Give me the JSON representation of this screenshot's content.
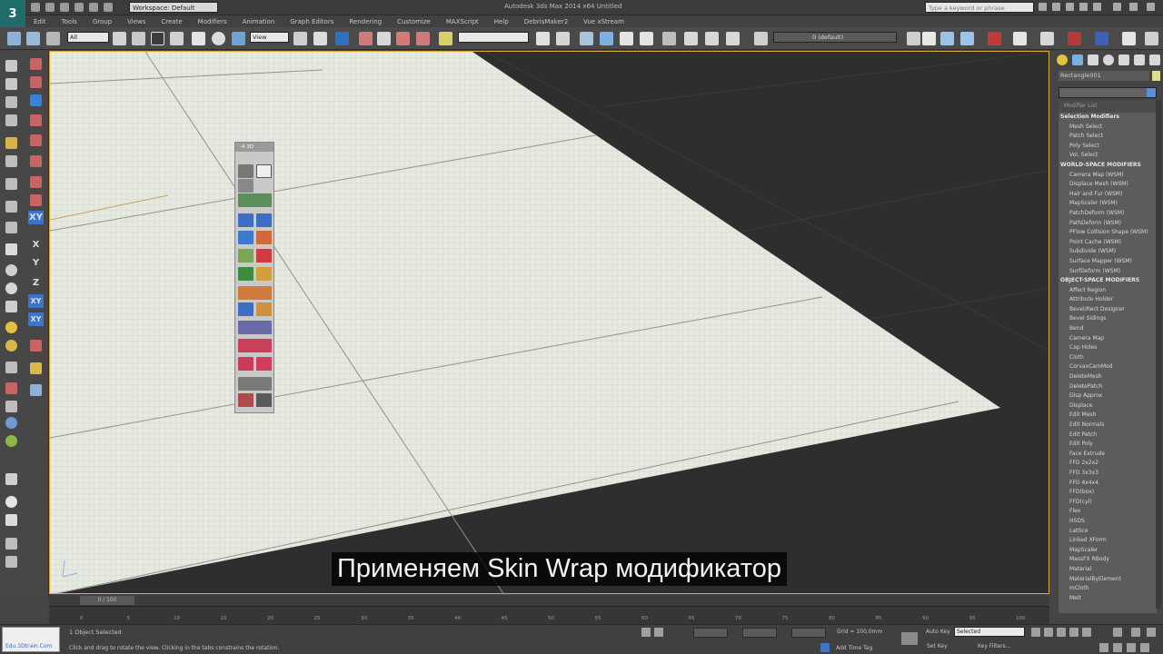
{
  "titlebar": {
    "workspace": "Workspace: Default",
    "app_title": "Autodesk 3ds Max  2014 x64     Untitled",
    "search_placeholder": "Type a keyword or phrase"
  },
  "menu": [
    "Edit",
    "Tools",
    "Group",
    "Views",
    "Create",
    "Modifiers",
    "Animation",
    "Graph Editors",
    "Rendering",
    "Customize",
    "MAXScript",
    "Help",
    "DebrisMaker2",
    "Vue xStream"
  ],
  "toolbar": {
    "selection_filter": "All",
    "ref_coord": "View",
    "layer": "0 (default)"
  },
  "left_axes": [
    "XY",
    "X",
    "Y",
    "Z",
    "XY",
    "XY"
  ],
  "viewport": {
    "subtitle": "Применяем Skin Wrap модификатор",
    "colors": {
      "plane": "#e5e9e0",
      "grid": "#8f9490",
      "bg": "#2e2e2e",
      "border": "#d9a93a"
    },
    "float_tb_title": "-4 3D"
  },
  "command_panel": {
    "object_name": "Rectangle001",
    "modifier_list_search": "Modifier List",
    "modifier_groups": [
      {
        "header": "Selection Modifiers",
        "items": [
          "Mesh Select",
          "Patch Select",
          "Poly Select",
          "Vol. Select"
        ]
      },
      {
        "header": "WORLD-SPACE MODIFIERS",
        "items": [
          "Camera Map (WSM)",
          "Displace Mesh (WSM)",
          "Hair and Fur (WSM)",
          "MapScaler (WSM)",
          "PatchDeform (WSM)",
          "PathDeform (WSM)",
          "PFlow Collision Shape (WSM)",
          "Point Cache (WSM)",
          "Subdivide (WSM)",
          "Surface Mapper (WSM)",
          "SurfDeform (WSM)"
        ]
      },
      {
        "header": "OBJECT-SPACE MODIFIERS",
        "items": [
          "Affect Region",
          "Attribute Holder",
          "Bevel/Rect Designer",
          "Bevel Sidings",
          "Bend",
          "Camera Map",
          "Cap Holes",
          "Cloth",
          "CorvaxCamMod",
          "DeleteMesh",
          "DeletePatch",
          "Disp Approx",
          "Displace",
          "Edit Mesh",
          "Edit Normals",
          "Edit Patch",
          "Edit Poly",
          "Face Extrude",
          "FFD 2x2x2",
          "FFD 3x3x3",
          "FFD 4x4x4",
          "FFD(box)",
          "FFD(cyl)",
          "Flex",
          "HSDS",
          "Lattice",
          "Linked XForm",
          "MapScaler",
          "MassFX RBody",
          "Material",
          "MaterialByElement",
          "mCloth",
          "Melt"
        ]
      }
    ]
  },
  "timeline": {
    "frame_label": "0 / 100",
    "ticks": [
      "0",
      "5",
      "10",
      "15",
      "20",
      "25",
      "30",
      "35",
      "40",
      "45",
      "50",
      "55",
      "60",
      "65",
      "70",
      "75",
      "80",
      "85",
      "90",
      "95",
      "100"
    ]
  },
  "status": {
    "brand": "Edu.3Dtrain.Com",
    "selected": "1 Object Selected",
    "prompt": "Click and drag to rotate the view.  Clicking in the tabs constrains the rotation.",
    "grid": "Grid = 100,0mm",
    "add_time_tag": "Add Time Tag",
    "auto_key": "Auto Key",
    "set_key": "Set Key",
    "selected_dd": "Selected",
    "key_filters": "Key Filters..."
  }
}
